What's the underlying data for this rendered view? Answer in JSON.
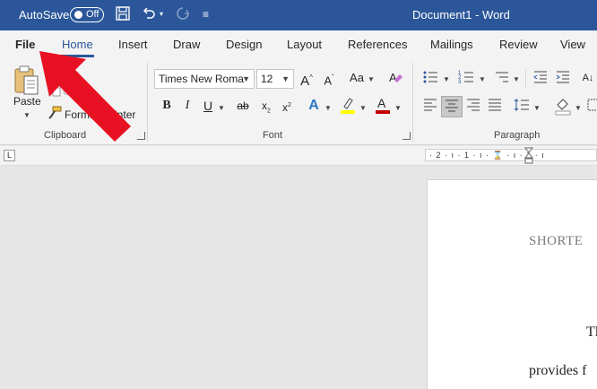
{
  "titlebar": {
    "autosave_label": "AutoSave",
    "autosave_state": "Off",
    "document_title": "Document1 - Word"
  },
  "tabs": [
    {
      "label": "File"
    },
    {
      "label": "Home"
    },
    {
      "label": "Insert"
    },
    {
      "label": "Draw"
    },
    {
      "label": "Design"
    },
    {
      "label": "Layout"
    },
    {
      "label": "References"
    },
    {
      "label": "Mailings"
    },
    {
      "label": "Review"
    },
    {
      "label": "View"
    }
  ],
  "clipboard": {
    "paste_label": "Paste",
    "copy_label": "Copy",
    "format_painter_label": "Format Painter",
    "group_label": "Clipboard"
  },
  "font": {
    "font_name": "Times New Roma",
    "font_size": "12",
    "group_label": "Font"
  },
  "paragraph": {
    "group_label": "Paragraph"
  },
  "ruler": {
    "text": "· 2 · ı · 1 · ı · ⌛ · ı · 1 · ı"
  },
  "document": {
    "line1": "SHORTE",
    "line2": "Tl",
    "line3": "provides f"
  },
  "colors": {
    "title_bar": "#2b579a",
    "arrow": "#e81123",
    "highlight": "#ffff00",
    "font_color": "#c00000"
  }
}
